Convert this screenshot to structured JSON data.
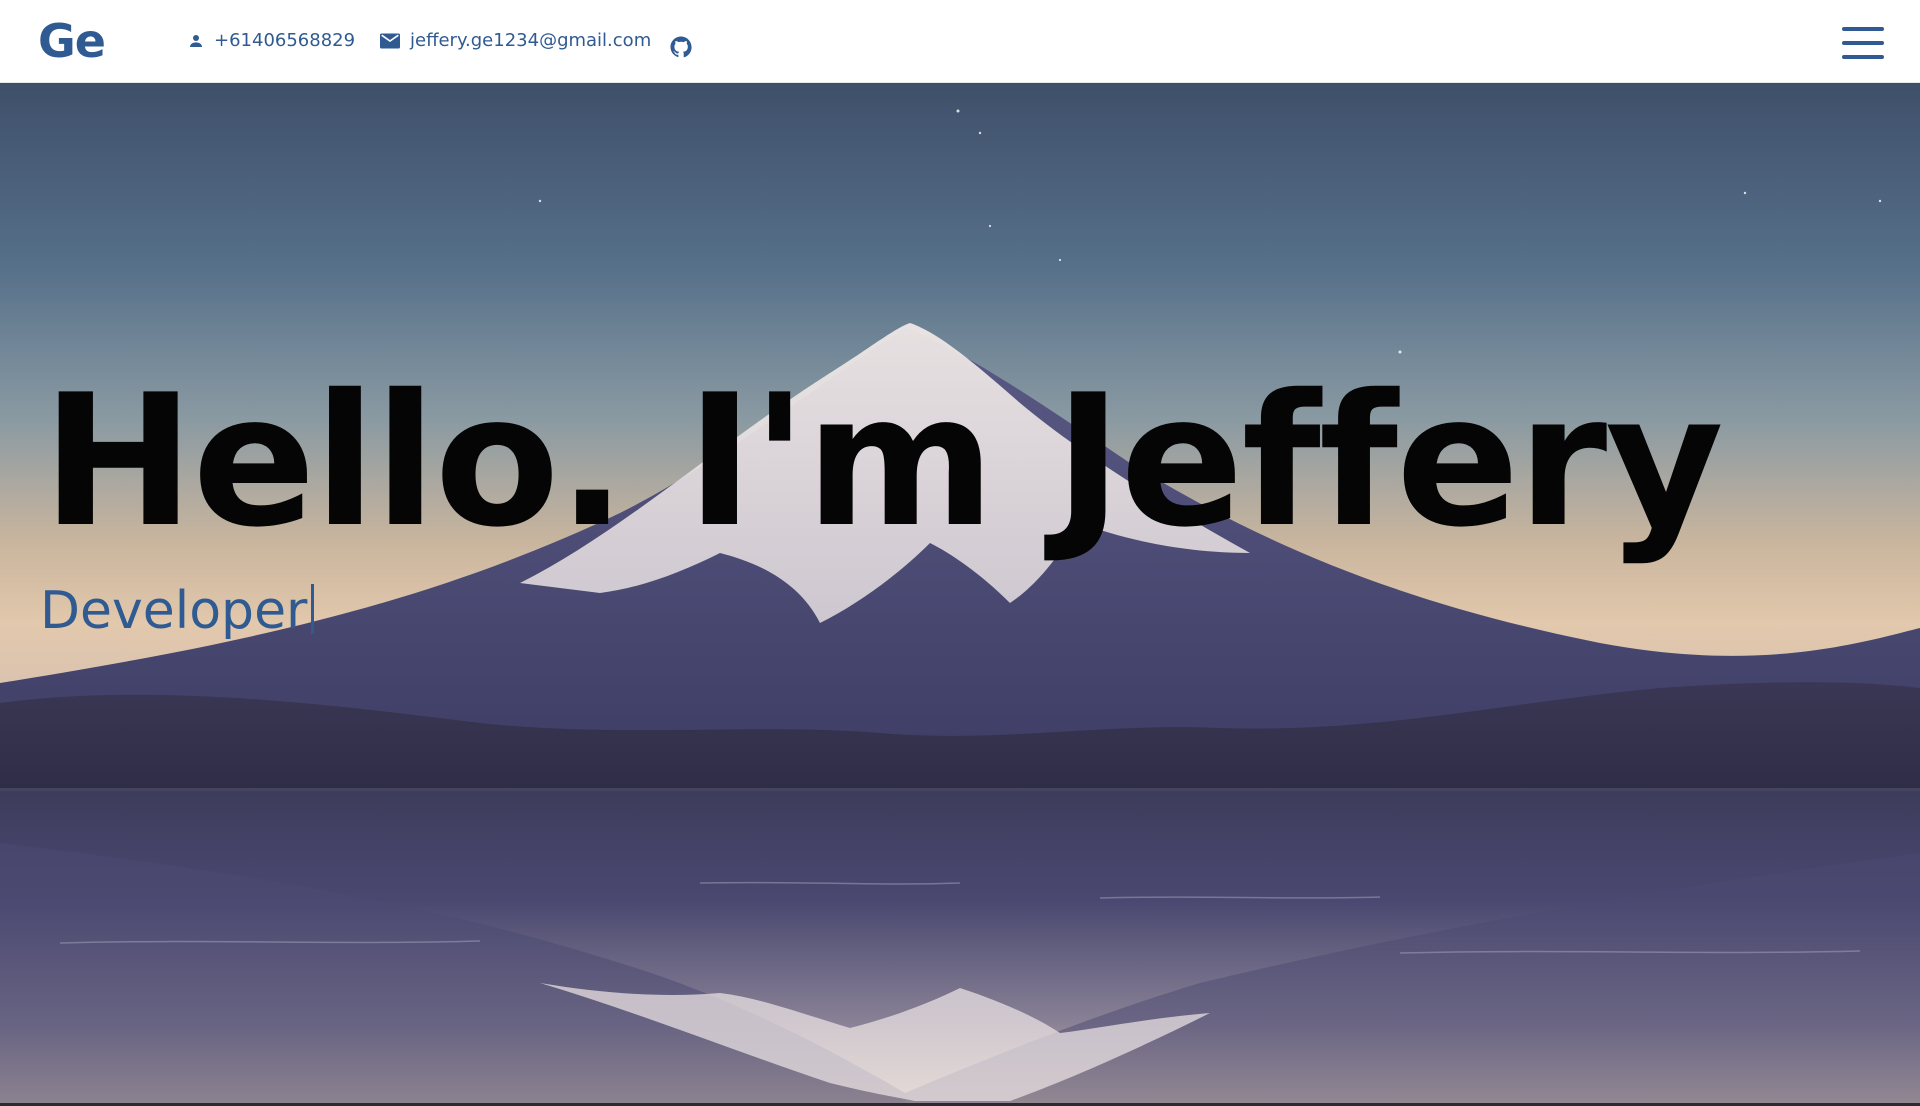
{
  "header": {
    "logo": "Ge",
    "phone": "+61406568829",
    "email": "jeffery.ge1234@gmail.com",
    "icons": {
      "phone": "person-icon",
      "email": "mail-icon",
      "github": "github-icon",
      "menu": "hamburger-menu-icon"
    }
  },
  "hero": {
    "title": "Hello. I'm Jeffery",
    "role": "Developer"
  },
  "colors": {
    "accent": "#2f5a92",
    "title": "#050505",
    "header_bg": "#ffffff"
  }
}
